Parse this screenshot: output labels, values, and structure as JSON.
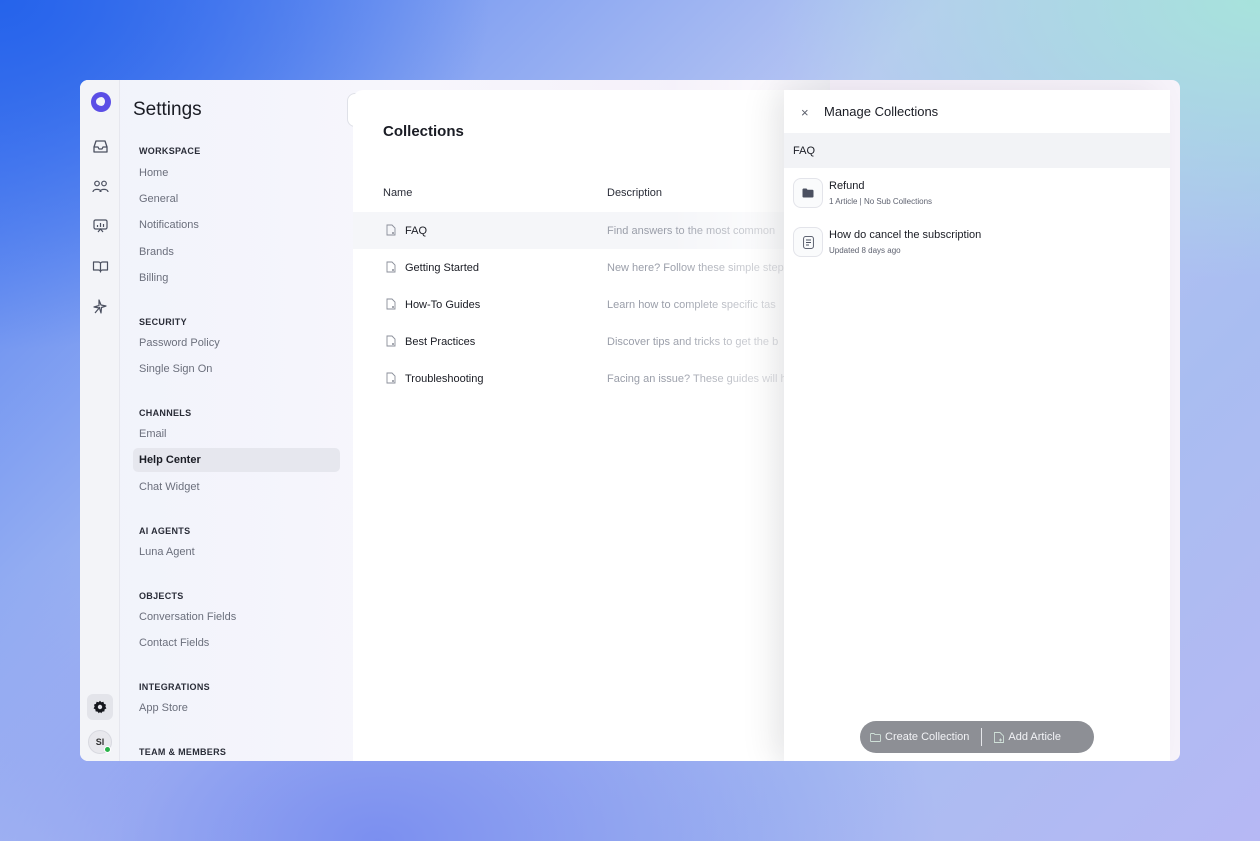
{
  "rail": {
    "icons": [
      "logo-icon",
      "inbox-icon",
      "contacts-icon",
      "reports-icon",
      "knowledge-icon",
      "ai-icon"
    ],
    "avatar_initials": "SI",
    "status_color": "#29b24a"
  },
  "sidebar": {
    "title": "Settings",
    "sections": [
      {
        "label": "WORKSPACE",
        "items": [
          "Home",
          "General",
          "Notifications",
          "Brands",
          "Billing"
        ]
      },
      {
        "label": "SECURITY",
        "items": [
          "Password Policy",
          "Single Sign On"
        ]
      },
      {
        "label": "CHANNELS",
        "items": [
          "Email",
          "Help Center",
          "Chat Widget"
        ]
      },
      {
        "label": "AI AGENTS",
        "items": [
          "Luna Agent"
        ]
      },
      {
        "label": "OBJECTS",
        "items": [
          "Conversation Fields",
          "Contact Fields"
        ]
      },
      {
        "label": "INTEGRATIONS",
        "items": [
          "App Store"
        ]
      },
      {
        "label": "TEAM & MEMBERS",
        "items": []
      }
    ],
    "active_item": "Help Center"
  },
  "main": {
    "heading": "Collections",
    "columns": {
      "name": "Name",
      "description": "Description"
    },
    "rows": [
      {
        "name": "FAQ",
        "description": "Find answers to the most common"
      },
      {
        "name": "Getting Started",
        "description": "New here? Follow these simple step"
      },
      {
        "name": "How-To Guides",
        "description": "Learn how to complete specific tas"
      },
      {
        "name": "Best Practices",
        "description": "Discover tips and tricks to get the b"
      },
      {
        "name": "Troubleshooting",
        "description": "Facing an issue? These guides will h"
      }
    ]
  },
  "panel": {
    "close_glyph": "×",
    "title": "Manage Collections",
    "breadcrumb": "FAQ",
    "items": [
      {
        "title": "Refund",
        "subtitle": "1 Article | No Sub Collections",
        "icon": "folder-icon"
      },
      {
        "title": "How do cancel the subscription",
        "subtitle": "Updated 8 days ago",
        "icon": "article-icon"
      }
    ],
    "actions": {
      "create": "Create Collection",
      "add": "Add Article"
    }
  },
  "colors": {
    "accent": "#5b4ee6",
    "action_bar": "#8d8f95"
  }
}
